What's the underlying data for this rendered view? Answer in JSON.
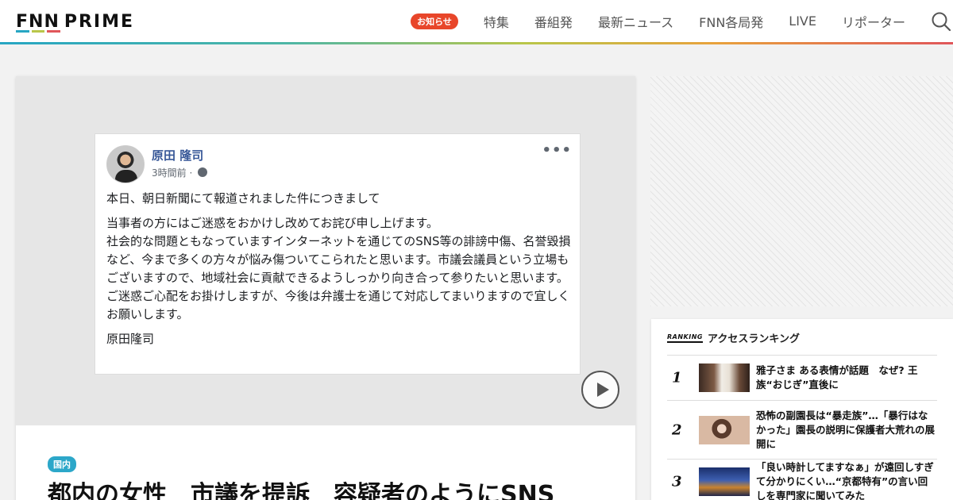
{
  "header": {
    "logo_fnn": "FNN",
    "logo_prime": "PRIME",
    "logo_bar_colors": [
      "#27a6c3",
      "#b9c64a",
      "#e0565a"
    ],
    "badge": "お知らせ",
    "nav": [
      "特集",
      "番組発",
      "最新ニュース",
      "FNN各局発",
      "LIVE",
      "リポーター"
    ],
    "search_icon": "search-icon"
  },
  "post": {
    "author": "原田 隆司",
    "time": "3時間前",
    "privacy_icon": "globe-icon",
    "more_icon": "more-dots-icon",
    "paragraphs": [
      "本日、朝日新聞にて報道されました件につきまして",
      "当事者の方にはご迷惑をおかけし改めてお詫び申し上げます。\n社会的な問題ともなっていますインターネットを通じてのSNS等の誹謗中傷、名誉毀損など、今まで多くの方々が悩み傷ついてこられたと思います。市議会議員という立場もございますので、地域社会に貢献できるようしっかり向き合って参りたいと思います。\nご迷惑ご心配をお掛けしますが、今後は弁護士を通じて対応してまいりますので宜しくお願いします。",
      "原田隆司"
    ]
  },
  "article": {
    "category": "国内",
    "category_color": "#2ca7c9",
    "title": "都内の女性　市議を提訴　容疑者のようにSNS"
  },
  "ranking": {
    "tag": "RANKING",
    "title": "アクセスランキング",
    "items": [
      {
        "rank": "1",
        "text": "雅子さま ある表情が話題　なぜ? 王族“おじぎ”直後に"
      },
      {
        "rank": "2",
        "text": "恐怖の副園長は“暴走族”…「暴行はなかった」園長の説明に保護者大荒れの展開に"
      },
      {
        "rank": "3",
        "text": "「良い時計してますなぁ」が遠回しすぎて分かりにくい…“京都特有”の言い回しを専門家に聞いてみた"
      }
    ]
  }
}
